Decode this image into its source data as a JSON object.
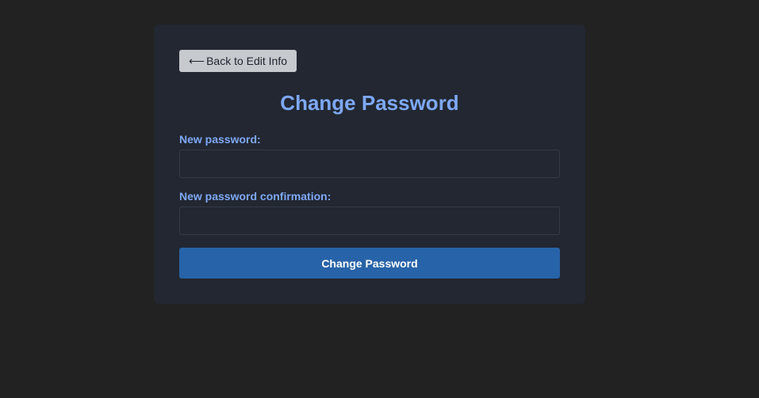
{
  "back_button": {
    "arrow": "⟵",
    "label": "Back to Edit Info"
  },
  "page_title": "Change Password",
  "form": {
    "new_password": {
      "label": "New password:",
      "value": "",
      "placeholder": ""
    },
    "confirmation": {
      "label": "New password confirmation:",
      "value": "",
      "placeholder": ""
    },
    "submit_label": "Change Password"
  },
  "colors": {
    "page_background": "#222222",
    "card_background": "#222731",
    "accent": "#7ea8f6",
    "primary_button": "#2763a8",
    "secondary_button": "#c6c9cd"
  }
}
